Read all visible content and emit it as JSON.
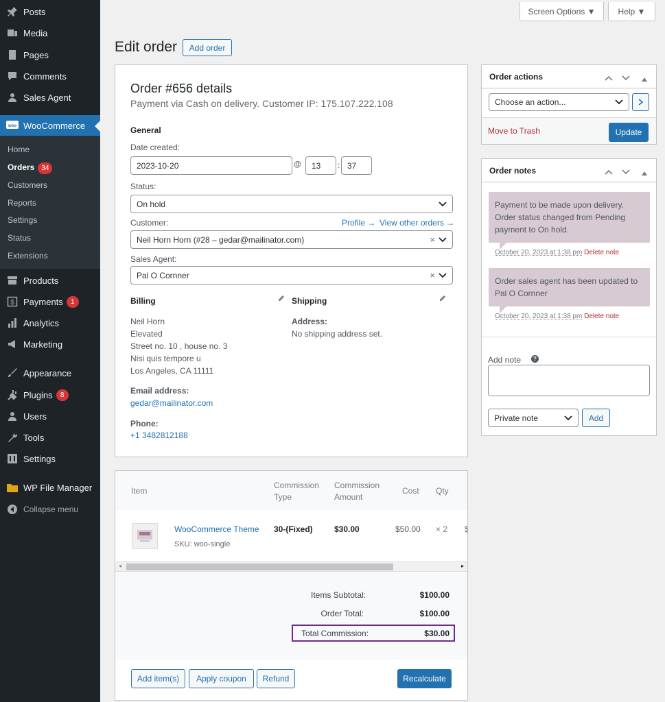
{
  "sidebar": {
    "posts": "Posts",
    "media": "Media",
    "pages": "Pages",
    "comments": "Comments",
    "sales_agent": "Sales Agent",
    "woocommerce": "WooCommerce",
    "sub": {
      "home": "Home",
      "orders": "Orders",
      "orders_badge": "34",
      "customers": "Customers",
      "reports": "Reports",
      "settings": "Settings",
      "status": "Status",
      "extensions": "Extensions"
    },
    "products": "Products",
    "payments": "Payments",
    "payments_badge": "1",
    "analytics": "Analytics",
    "marketing": "Marketing",
    "appearance": "Appearance",
    "plugins": "Plugins",
    "plugins_badge": "8",
    "users": "Users",
    "tools": "Tools",
    "settings": "Settings",
    "wp_file_manager": "WP File Manager",
    "collapse": "Collapse menu"
  },
  "topbar": {
    "screen_options": "Screen Options ▼",
    "help": "Help ▼"
  },
  "page": {
    "title": "Edit order",
    "add_order": "Add order"
  },
  "order": {
    "heading": "Order #656 details",
    "subheading": "Payment via Cash on delivery. Customer IP: 175.107.222.108",
    "general": "General",
    "date_label": "Date created:",
    "date": "2023-10-20",
    "at": "@",
    "hour": "13",
    "colon": ":",
    "minute": "37",
    "status_label": "Status:",
    "status": "On hold",
    "customer_label": "Customer:",
    "profile_link": "Profile →",
    "view_orders_link": "View other orders →",
    "customer": "Neil Horn Horn (#28 – gedar@mailinator.com)",
    "agent_label": "Sales Agent:",
    "agent": "Pal O Cornner",
    "clear": "×",
    "billing": "Billing",
    "billing_lines": [
      "Neil Horn",
      "Elevated",
      "Street no. 10 , house no. 3",
      "Nisi quis tempore u",
      "Los Angeles, CA 11111"
    ],
    "email_label": "Email address:",
    "email": "gedar@mailinator.com",
    "phone_label": "Phone:",
    "phone": "+1 3482812188",
    "shipping": "Shipping",
    "address_label": "Address:",
    "no_shipping": "No shipping address set."
  },
  "items": {
    "headers": {
      "item": "Item",
      "commission_type": "Commission Type",
      "commission_amount": "Commission Amount",
      "cost": "Cost",
      "qty": "Qty"
    },
    "rows": [
      {
        "name": "WooCommerce Theme",
        "sku": "SKU: woo-single",
        "commission_type": "30-(Fixed)",
        "commission_amount": "$30.00",
        "cost": "$50.00",
        "qty": "× 2",
        "overflow": "$"
      }
    ],
    "totals": {
      "subtotal_label": "Items Subtotal:",
      "subtotal": "$100.00",
      "total_label": "Order Total:",
      "total": "$100.00",
      "commission_label": "Total Commission:",
      "commission": "$30.00"
    },
    "buttons": {
      "add_items": "Add item(s)",
      "apply_coupon": "Apply coupon",
      "refund": "Refund",
      "recalculate": "Recalculate"
    }
  },
  "actions": {
    "title": "Order actions",
    "select": "Choose an action...",
    "trash": "Move to Trash",
    "update": "Update"
  },
  "notes": {
    "title": "Order notes",
    "list": [
      {
        "text": "Payment to be made upon delivery. Order status changed from Pending payment to On hold.",
        "date": "October 20, 2023 at 1:38 pm",
        "delete": "Delete note"
      },
      {
        "text": "Order sales agent has been updated to Pal O Cornner",
        "date": "October 20, 2023 at 1:38 pm",
        "delete": "Delete note"
      }
    ],
    "add_label": "Add note",
    "help_icon": "?",
    "type": "Private note",
    "add_button": "Add"
  },
  "colors": {
    "sidebar": "#1d2327",
    "accent": "#2271b1",
    "highlight": "#6b2c91",
    "note": "#d7cad2",
    "badge": "#d63638"
  }
}
